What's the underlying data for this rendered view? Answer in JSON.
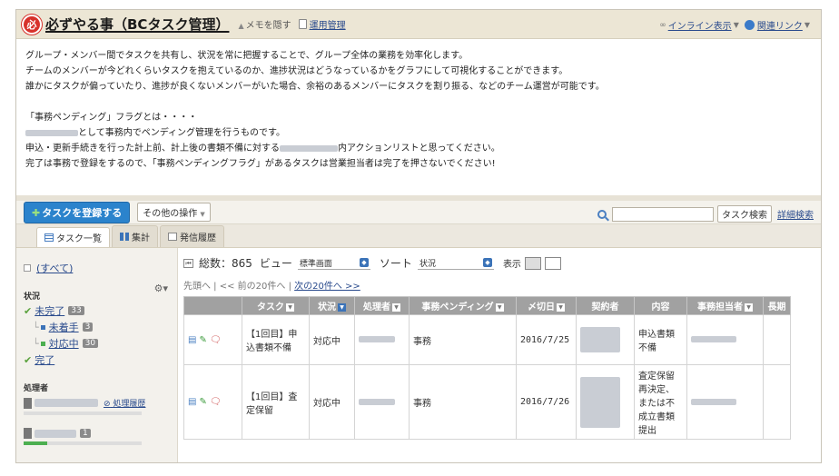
{
  "header": {
    "logo_text": "必",
    "title": "必ずやる事（BCタスク管理）",
    "hide_memo": "メモを隠す",
    "ops_link": "運用管理",
    "inline_display": "インライン表示",
    "related_links": "関連リンク"
  },
  "memo": {
    "lines": [
      "グループ・メンバー間でタスクを共有し、状況を常に把握することで、グループ全体の業務を効率化します。",
      "チームのメンバーが今どれくらいタスクを抱えているのか、進捗状況はどうなっているかをグラフにして可視化することができます。",
      "誰かにタスクが偏っていたり、進捗が良くないメンバーがいた場合、余裕のあるメンバーにタスクを割り振る、などのチーム運営が可能です。",
      "",
      "「事務ペンディング」フラグとは・・・・",
      "として事務内でペンディング管理を行うものです。",
      "申込・更新手続きを行った計上前、計上後の書類不備に対する",
      "内アクションリストと思ってください。",
      "完了は事務で登録をするので、「事務ペンディングフラグ」があるタスクは営業担当者は完了を押さないでください!"
    ]
  },
  "toolbar": {
    "register_label": "タスクを登録する",
    "other_ops_label": "その他の操作",
    "search_button": "タスク検索",
    "advanced_search": "詳細検索"
  },
  "tabs": [
    "タスク一覧",
    "集計",
    "発信履歴"
  ],
  "sidebar": {
    "all_label": "(すべて)",
    "status_label": "状況",
    "statuses": {
      "incomplete": {
        "label": "未完了",
        "count": "33"
      },
      "not_started": {
        "label": "未着手",
        "count": "3"
      },
      "in_progress": {
        "label": "対応中",
        "count": "30"
      },
      "complete": {
        "label": "完了"
      }
    },
    "assignee_label": "処理者",
    "history_link": "処理履歴",
    "person2_count": "1",
    "colors": {
      "not_started": "#3b73b8",
      "in_progress": "#4caf50"
    }
  },
  "list": {
    "total_label": "総数：865",
    "view_label": "ビュー",
    "view_value": "標準画面",
    "sort_label": "ソート",
    "sort_value": "状況",
    "display_label": "表示",
    "pager": {
      "first": "先頭へ",
      "prev": "<< 前の20件へ",
      "next": "次の20件へ >>"
    },
    "columns": [
      "",
      "タスク",
      "状況",
      "処理者",
      "事務ペンディング",
      "〆切日",
      "契約者",
      "内容",
      "事務担当者",
      "長期"
    ],
    "rows": [
      {
        "task": "【1回目】申込書類不備",
        "status": "対応中",
        "pending": "事務",
        "deadline": "2016/7/25",
        "content": "申込書類不備"
      },
      {
        "task": "【1回目】査定保留",
        "status": "対応中",
        "pending": "事務",
        "deadline": "2016/7/26",
        "content": "査定保留再決定、または不成立書類提出"
      }
    ]
  }
}
